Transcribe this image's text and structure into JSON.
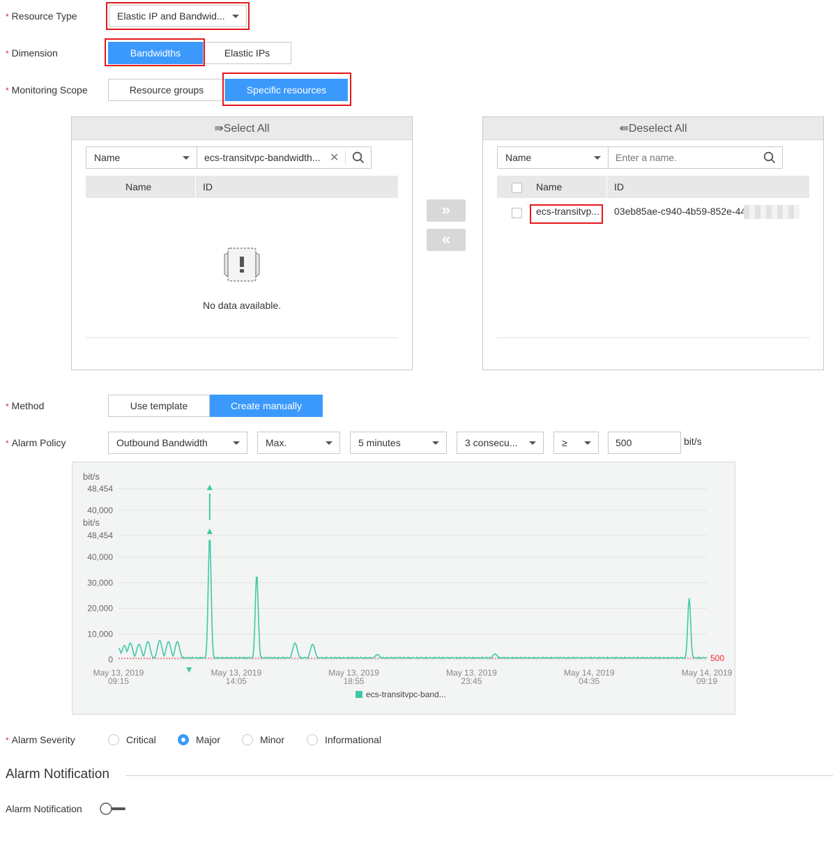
{
  "form": {
    "resource_type": {
      "label": "Resource Type",
      "value": "Elastic IP and Bandwid..."
    },
    "dimension": {
      "label": "Dimension",
      "options": [
        "Bandwidths",
        "Elastic IPs"
      ],
      "selected": 0
    },
    "monitoring_scope": {
      "label": "Monitoring Scope",
      "options": [
        "Resource groups",
        "Specific resources"
      ],
      "selected": 1
    }
  },
  "transfer": {
    "left": {
      "header": "⇛Select  All",
      "filter_field": "Name",
      "filter_value": "ecs-transitvpc-bandwidth...",
      "columns": [
        "Name",
        "ID"
      ],
      "empty_text": "No data available."
    },
    "right": {
      "header": "⇚Deselect  All",
      "filter_field": "Name",
      "filter_placeholder": "Enter a name.",
      "columns": [
        "Name",
        "ID"
      ],
      "rows": [
        {
          "name": "ecs-transitvp...",
          "id": "03eb85ae-c940-4b59-852e-44"
        }
      ]
    },
    "move_right": "»",
    "move_left": "«"
  },
  "method": {
    "label": "Method",
    "options": [
      "Use template",
      "Create manually"
    ],
    "selected": 1
  },
  "alarm_policy": {
    "label": "Alarm Policy",
    "metric": "Outbound Bandwidth",
    "statistic": "Max.",
    "period": "5 minutes",
    "consecutive": "3 consecu...",
    "operator": "≥",
    "threshold": "500",
    "unit": "bit/s"
  },
  "chart_data": {
    "type": "line",
    "ylabel": "bit/s",
    "y_ticks": [
      "0",
      "10,000",
      "20,000",
      "30,000",
      "40,000",
      "48,454"
    ],
    "ylim": [
      0,
      48454
    ],
    "upper_ylabel": "bit/s",
    "upper_ticks": [
      "48,454",
      "40,000"
    ],
    "x_ticks": [
      {
        "date": "May 13, 2019",
        "time": "09:15"
      },
      {
        "date": "May 13, 2019",
        "time": "14:05"
      },
      {
        "date": "May 13, 2019",
        "time": "18:55"
      },
      {
        "date": "May 13, 2019",
        "time": "23:45"
      },
      {
        "date": "May 14, 2019",
        "time": "04:35"
      },
      {
        "date": "May 14, 2019",
        "time": "09:19"
      }
    ],
    "threshold_label": "500",
    "threshold": 500,
    "series": [
      {
        "name": "ecs-transitvpc-band...",
        "color": "#3ec9a7"
      }
    ],
    "peaks": [
      {
        "x": 0.0,
        "y": 4500
      },
      {
        "x": 0.01,
        "y": 5500
      },
      {
        "x": 0.02,
        "y": 6500
      },
      {
        "x": 0.035,
        "y": 6000
      },
      {
        "x": 0.05,
        "y": 7000
      },
      {
        "x": 0.07,
        "y": 7500
      },
      {
        "x": 0.085,
        "y": 7000
      },
      {
        "x": 0.1,
        "y": 7000
      },
      {
        "x": 0.155,
        "y": 48454
      },
      {
        "x": 0.235,
        "y": 33500
      },
      {
        "x": 0.3,
        "y": 6500
      },
      {
        "x": 0.33,
        "y": 6000
      },
      {
        "x": 0.44,
        "y": 2000
      },
      {
        "x": 0.64,
        "y": 2200
      },
      {
        "x": 0.97,
        "y": 24000
      }
    ],
    "markers": [
      "max",
      "min"
    ]
  },
  "severity": {
    "label": "Alarm Severity",
    "options": [
      "Critical",
      "Major",
      "Minor",
      "Informational"
    ],
    "selected": 1
  },
  "notification": {
    "section_title": "Alarm Notification",
    "label": "Alarm Notification",
    "enabled": false
  },
  "colors": {
    "primary": "#3b99fc",
    "highlight_box": "#e4171b",
    "line": "#3ec9a7",
    "threshold": "#f5222d"
  }
}
